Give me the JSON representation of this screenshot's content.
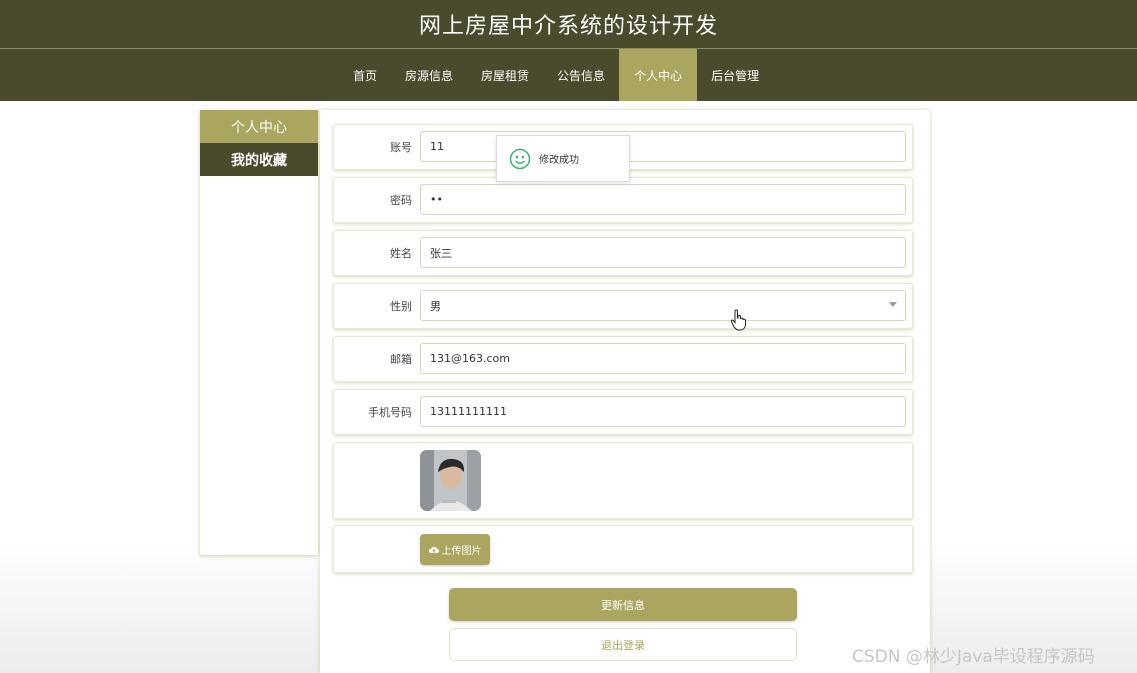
{
  "header": {
    "title": "网上房屋中介系统的设计开发"
  },
  "nav": {
    "items": [
      "首页",
      "房源信息",
      "房屋租赁",
      "公告信息",
      "个人中心",
      "后台管理"
    ],
    "active_index": 4
  },
  "sidebar": {
    "items": [
      "个人中心",
      "我的收藏"
    ]
  },
  "form": {
    "account_label": "账号",
    "account_value": "11",
    "password_label": "密码",
    "password_value": "••",
    "name_label": "姓名",
    "name_value": "张三",
    "gender_label": "性别",
    "gender_value": "男",
    "email_label": "邮箱",
    "email_value": "131@163.com",
    "phone_label": "手机号码",
    "phone_value": "13111111111",
    "upload_label": "上传图片",
    "update_button": "更新信息",
    "logout_button": "退出登录"
  },
  "toast": {
    "message": "修改成功",
    "icon": "smile-icon"
  },
  "watermark": "CSDN @林少Java毕设程序源码",
  "colors": {
    "dark": "#4a4a2c",
    "accent": "#aaa65f",
    "toast_icon": "#3cb371"
  }
}
